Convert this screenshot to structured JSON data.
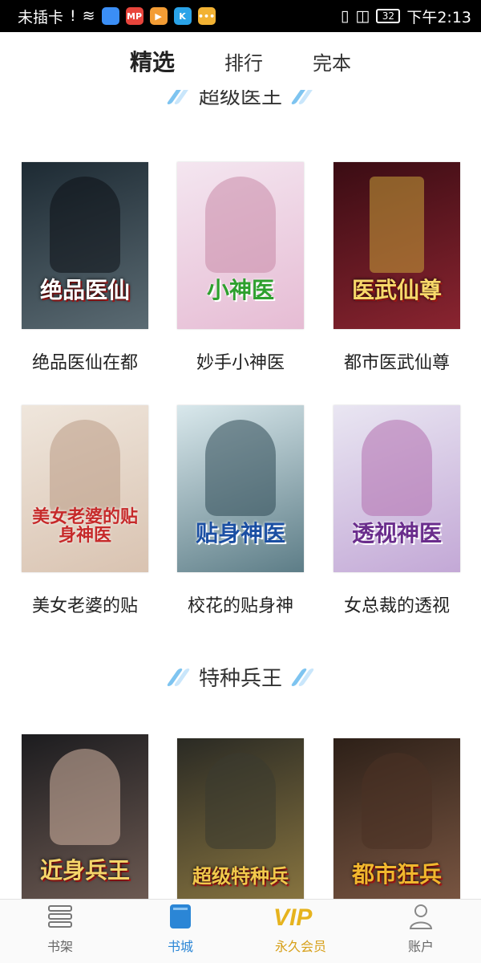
{
  "status_bar": {
    "carrier": "未插卡",
    "app_icons": [
      {
        "name": "qq-browser-icon",
        "label": "",
        "color": "#3b8ef5"
      },
      {
        "name": "mp-icon",
        "label": "MP",
        "color": "#e8453c"
      },
      {
        "name": "video-icon",
        "label": "▶",
        "color": "#f39c34"
      },
      {
        "name": "k-icon",
        "label": "K",
        "color": "#2aa3e8"
      },
      {
        "name": "more-icon",
        "label": "•••",
        "color": "#f2b233"
      }
    ],
    "battery": "32",
    "time": "下午2:13"
  },
  "top_tabs": [
    {
      "label": "精选",
      "active": true
    },
    {
      "label": "排行",
      "active": false
    },
    {
      "label": "完本",
      "active": false
    }
  ],
  "sections": [
    {
      "title": "超级医王",
      "books": [
        {
          "title": "绝品医仙在都",
          "cover_text": "绝品医仙",
          "colors": [
            "#1d2a33",
            "#5b6b73"
          ]
        },
        {
          "title": "妙手小神医",
          "cover_text": "小神医",
          "colors": [
            "#f4e6f0",
            "#e6bcd4"
          ]
        },
        {
          "title": "都市医武仙尊",
          "cover_text": "医武仙尊",
          "colors": [
            "#3a0c13",
            "#8a2430"
          ]
        }
      ]
    },
    {
      "title": "",
      "books": [
        {
          "title": "美女老婆的贴",
          "cover_text": "美女老婆的贴身神医",
          "colors": [
            "#efe6dc",
            "#d9c3b1"
          ]
        },
        {
          "title": "校花的贴身神",
          "cover_text": "贴身神医",
          "colors": [
            "#d9e8ec",
            "#5d7d87"
          ]
        },
        {
          "title": "女总裁的透视",
          "cover_text": "透视神医",
          "colors": [
            "#e9e6f2",
            "#c3a8d6"
          ]
        }
      ]
    },
    {
      "title": "特种兵王",
      "books": [
        {
          "title": "",
          "cover_text": "近身兵王",
          "colors": [
            "#1c1c1f",
            "#6d5a52"
          ]
        },
        {
          "title": "",
          "cover_text": "超级特种兵",
          "colors": [
            "#2a2a24",
            "#8a7640"
          ]
        },
        {
          "title": "",
          "cover_text": "都市狂兵",
          "colors": [
            "#2d2018",
            "#7a5642"
          ]
        }
      ]
    }
  ],
  "bottom_nav": [
    {
      "label": "书架",
      "icon": "bookshelf-icon",
      "state": "normal"
    },
    {
      "label": "书城",
      "icon": "book-store-icon",
      "state": "active"
    },
    {
      "label": "永久会员",
      "icon": "vip-icon",
      "state": "vip"
    },
    {
      "label": "账户",
      "icon": "account-icon",
      "state": "normal"
    }
  ],
  "colors": {
    "accent": "#2b86d6",
    "vip": "#d7a01a"
  }
}
